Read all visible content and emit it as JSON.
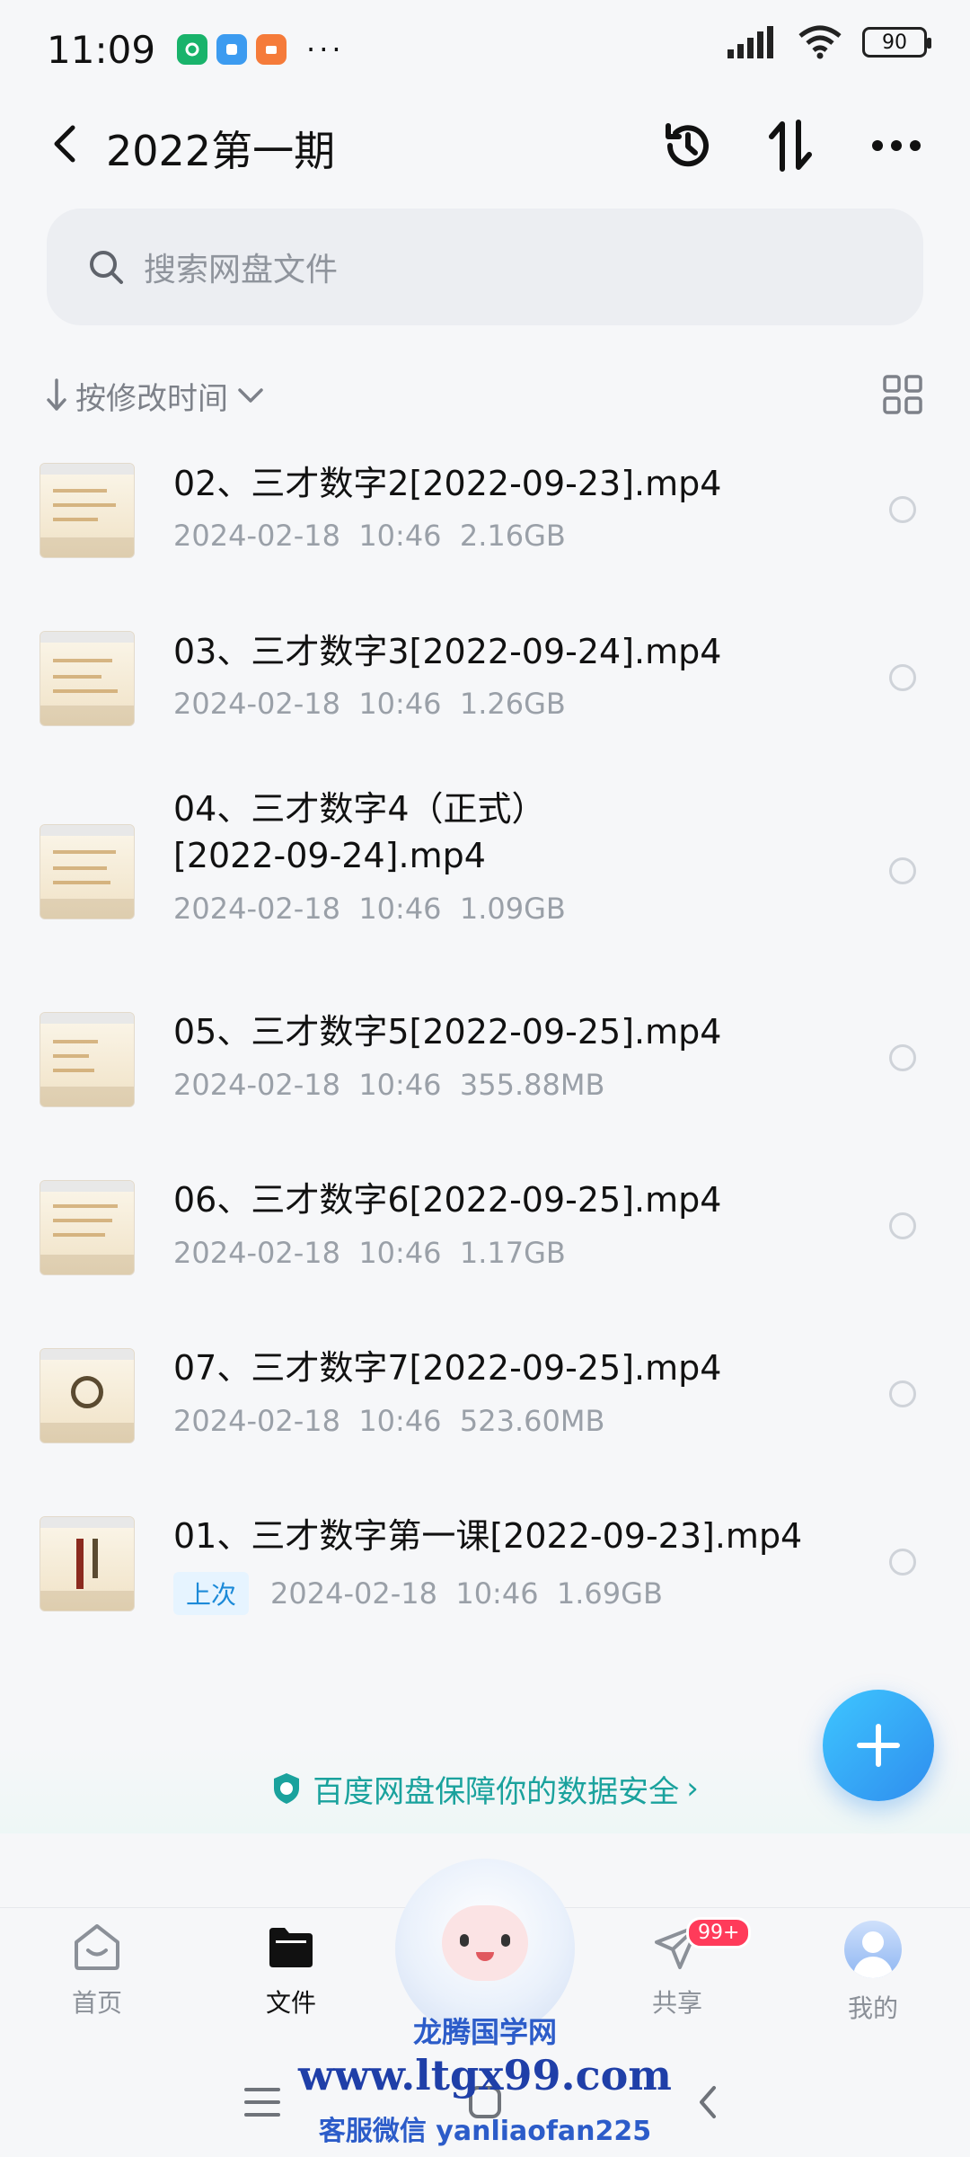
{
  "status_bar": {
    "time": "11:09",
    "battery": "90",
    "app_icons": [
      "green-app-icon",
      "blue-app-icon",
      "orange-app-icon"
    ],
    "more_glyph": "···"
  },
  "header": {
    "title": "2022第一期",
    "icons": [
      "history-icon",
      "sort-swap-icon",
      "more-icon"
    ]
  },
  "search": {
    "placeholder": "搜索网盘文件"
  },
  "sort": {
    "label": "按修改时间"
  },
  "files": [
    {
      "name": "02、三才数字2[2022-09-23].mp4",
      "date": "2024-02-18",
      "time": "10:46",
      "size": "2.16GB"
    },
    {
      "name": "03、三才数字3[2022-09-24].mp4",
      "date": "2024-02-18",
      "time": "10:46",
      "size": "1.26GB"
    },
    {
      "name_line1": "04、三才数字4（正式）",
      "name_line2": "[2022-09-24].mp4",
      "date": "2024-02-18",
      "time": "10:46",
      "size": "1.09GB"
    },
    {
      "name": "05、三才数字5[2022-09-25].mp4",
      "date": "2024-02-18",
      "time": "10:46",
      "size": "355.88MB"
    },
    {
      "name": "06、三才数字6[2022-09-25].mp4",
      "date": "2024-02-18",
      "time": "10:46",
      "size": "1.17GB"
    },
    {
      "name": "07、三才数字7[2022-09-25].mp4",
      "date": "2024-02-18",
      "time": "10:46",
      "size": "523.60MB"
    },
    {
      "name": "01、三才数字第一课[2022-09-23].mp4",
      "badge": "上次",
      "date": "2024-02-18",
      "time": "10:46",
      "size": "1.69GB"
    }
  ],
  "security_banner": {
    "text": "百度网盘保障你的数据安全",
    "chevron": "›"
  },
  "bottom_nav": [
    {
      "label": "首页"
    },
    {
      "label": "文件"
    },
    {
      "label": "共享",
      "badge": "99+"
    },
    {
      "label": "我的"
    }
  ],
  "watermark": {
    "line1": "龙腾国学网",
    "line2": "www.ltgx99.com",
    "line3": "客服微信 yanliaofan225"
  },
  "colors": {
    "accent": "#2f8dee",
    "security_green": "#1aa29d",
    "badge_red": "#ff3b5a"
  }
}
